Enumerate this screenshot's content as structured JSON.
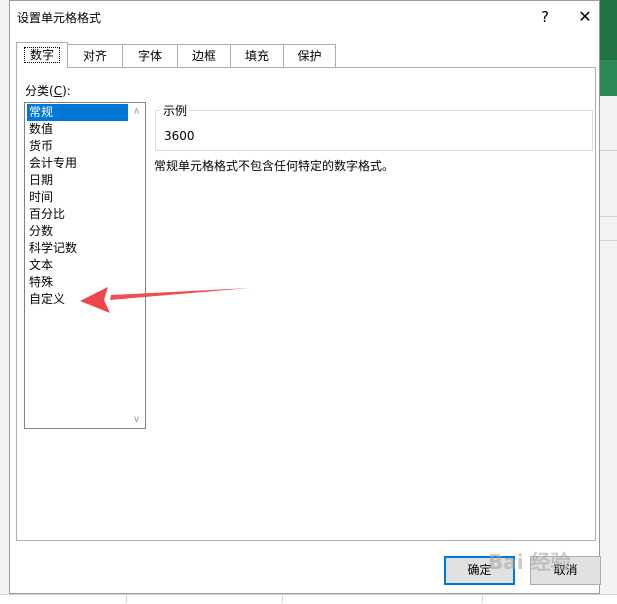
{
  "dialog": {
    "title": "设置单元格格式",
    "help_label": "?",
    "close_label": "✕"
  },
  "tabs": [
    {
      "label": "数字",
      "active": true
    },
    {
      "label": "对齐"
    },
    {
      "label": "字体"
    },
    {
      "label": "边框"
    },
    {
      "label": "填充"
    },
    {
      "label": "保护"
    }
  ],
  "category": {
    "label_prefix": "分类(",
    "label_key": "C",
    "label_suffix": "):",
    "items": [
      "常规",
      "数值",
      "货币",
      "会计专用",
      "日期",
      "时间",
      "百分比",
      "分数",
      "科学记数",
      "文本",
      "特殊",
      "自定义"
    ],
    "selected": "常规"
  },
  "sample": {
    "legend": "示例",
    "value": "3600"
  },
  "description": "常规单元格格式不包含任何特定的数字格式。",
  "buttons": {
    "ok": "确定",
    "cancel": "取消"
  },
  "annotation": {
    "arrow_color": "#f0454a",
    "points_to": "自定义"
  },
  "colors": {
    "selection": "#0078d7",
    "excel_green": "#217346"
  },
  "watermark": "Bai 经验"
}
